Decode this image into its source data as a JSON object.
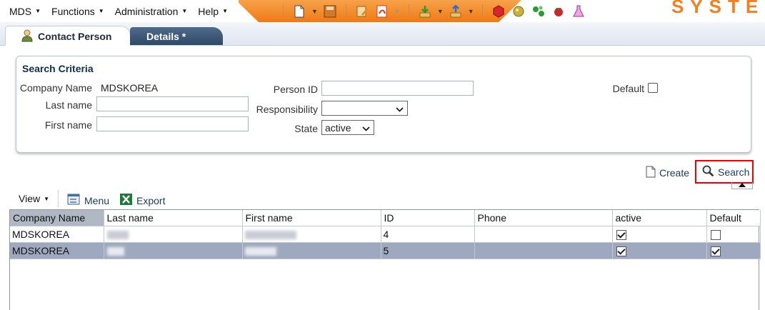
{
  "menubar": {
    "menus": [
      {
        "label": "MDS"
      },
      {
        "label": "Functions"
      },
      {
        "label": "Administration"
      },
      {
        "label": "Help"
      }
    ],
    "brand_text": "SYSTEN",
    "toolbar_icons": [
      "new-document-icon",
      "save-icon",
      "edit-icon",
      "pdf-icon",
      "download-icon",
      "upload-icon",
      "red-cube-icon",
      "gold-sphere-icon",
      "green-molecule-icon",
      "red-berry-icon",
      "flask-icon"
    ]
  },
  "tabs": [
    {
      "label": "Contact Person",
      "active": true
    },
    {
      "label": "Details *",
      "active": false
    }
  ],
  "search": {
    "title": "Search Criteria",
    "company_name_label": "Company Name",
    "company_name_value": "MDSKOREA",
    "last_name_label": "Last name",
    "first_name_label": "First name",
    "person_id_label": "Person ID",
    "responsibility_label": "Responsibility",
    "responsibility_value": "",
    "state_label": "State",
    "state_value": "active",
    "default_label": "Default",
    "default_checked": false
  },
  "actions": {
    "create_label": "Create",
    "search_label": "Search"
  },
  "grid_toolbar": {
    "view_label": "View",
    "menu_label": "Menu",
    "export_label": "Export"
  },
  "table": {
    "columns": [
      "Company Name",
      "Last name",
      "First name",
      "ID",
      "Phone",
      "active",
      "Default"
    ],
    "rows": [
      {
        "company": "MDSKOREA",
        "id": "4",
        "phone": "",
        "active": true,
        "default": false,
        "selected": false
      },
      {
        "company": "MDSKOREA",
        "id": "5",
        "phone": "",
        "active": true,
        "default": true,
        "selected": true
      }
    ]
  }
}
